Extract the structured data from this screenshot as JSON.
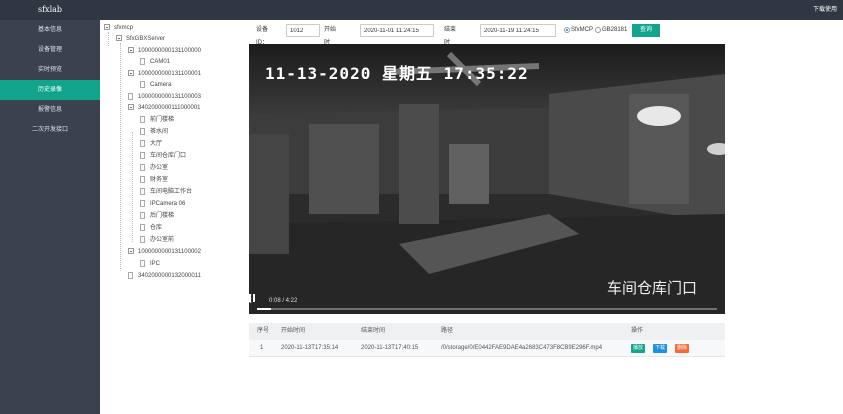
{
  "app": {
    "brand": "sfxlab",
    "top_link": "下载使用"
  },
  "sidebar": {
    "items": [
      {
        "label": "基本信息",
        "active": false
      },
      {
        "label": "设备管理",
        "active": false
      },
      {
        "label": "实时预览",
        "active": false
      },
      {
        "label": "历史录像",
        "active": true
      },
      {
        "label": "报警信息",
        "active": false
      },
      {
        "label": "二次开发接口",
        "active": false
      }
    ]
  },
  "tree": {
    "root": "sfxmcp",
    "server": "SfxGBXServer",
    "nodes": [
      "1000000000131100000",
      "CAM01",
      "1000000000131100001",
      "Camera",
      "1000000000131100003",
      "3402000000111000001",
      "前门楼梯",
      "茶水间",
      "大厅",
      "车间仓库门口",
      "办公室",
      "财务室",
      "车间电脑工作台",
      "IPCamera 06",
      "后门楼梯",
      "仓库",
      "办公室前",
      "1000000000131100002",
      "IPC",
      "3402000000132000011"
    ]
  },
  "filters": {
    "device_label": "设备ID：",
    "device_value": "1012",
    "start_label": "开始时间：",
    "start_value": "2020-11-01 11:24:15",
    "end_label": "结束时间：",
    "end_value": "2020-11-19 11:24:15",
    "radio1": "SfxMCP",
    "radio2": "GB28181",
    "query": "查询"
  },
  "video": {
    "osd_time": "11-13-2020 星期五 17:35:22",
    "osd_cam": "车间仓库门口",
    "time": "0:08 / 4:22",
    "progress": 0.03
  },
  "table": {
    "headers": [
      "序号",
      "开始时间",
      "结束时间",
      "路径",
      "操作"
    ],
    "rows": [
      {
        "no": "1",
        "start": "2020-11-13T17:35:14",
        "end": "2020-11-13T17:40:15",
        "path": "/0/storage/0/E0442FAE9DAE4a2683C473F8CB9E296F.mp4",
        "ops": [
          "播放",
          "下载",
          "删除"
        ]
      }
    ]
  },
  "colors": {
    "accent": "#12a58c",
    "download": "#1f8fe6",
    "delete": "#f26b3a",
    "sidebar": "#3a4250",
    "topbar": "#2e3742"
  }
}
